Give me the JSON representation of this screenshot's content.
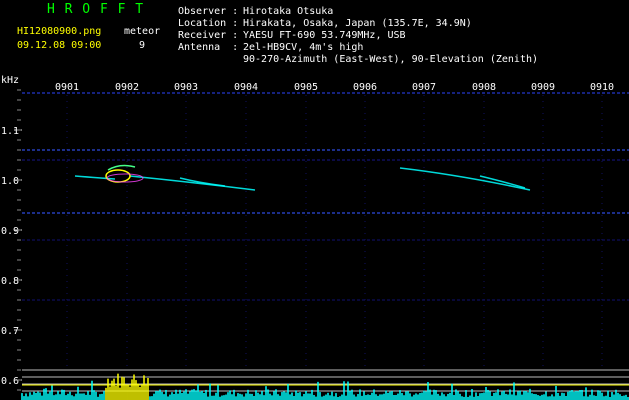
{
  "app": {
    "title": "H R O F F T",
    "filename": "HI12080900.png",
    "datetime": "09.12.08 09:00",
    "counter_label": "meteor",
    "counter_value": "9"
  },
  "info": {
    "observer_label": "Observer :",
    "observer_value": "Hirotaka Otsuka",
    "location_label": "Location :",
    "location_value": "Hirakata, Osaka, Japan (135.7E, 34.9N)",
    "receiver_label": "Receiver :",
    "receiver_value": "YAESU FT-690 53.749MHz, USB",
    "antenna_label": "Antenna  :",
    "antenna_value_1": "2el-HB9CV, 4m's high",
    "antenna_value_2": "90-270-Azimuth (East-West), 90-Elevation (Zenith)"
  },
  "axis": {
    "y_unit": "kHz",
    "y_ticks": [
      "1.1",
      "1.0",
      "0.9",
      "0.8",
      "0.7",
      "0.6"
    ],
    "x_ticks": [
      "0901",
      "0902",
      "0903",
      "0904",
      "0905",
      "0906",
      "0907",
      "0908",
      "0909",
      "0910"
    ]
  },
  "colors": {
    "title": "#00ff00",
    "text": "#ffffff",
    "meta": "#ffff00",
    "grid": "#1a1a9a",
    "signal": "#00ffff",
    "burst": "#ffff00"
  }
}
